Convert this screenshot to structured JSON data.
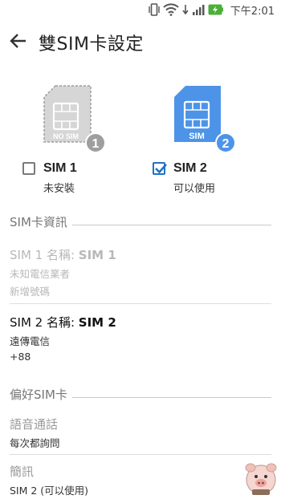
{
  "status_bar": {
    "time": "下午2:01",
    "icons": [
      "vibrate-icon",
      "wifi-icon",
      "signal-icon",
      "battery-charging-icon"
    ]
  },
  "app_bar": {
    "title": "雙SIM卡設定",
    "back_icon": "arrow-left-icon"
  },
  "sim_cards": [
    {
      "slot": "1",
      "graphic_label": "NO SIM",
      "label": "SIM 1",
      "status": "未安裝",
      "checked": false,
      "color": "#9e9e9e"
    },
    {
      "slot": "2",
      "graphic_label": "SIM",
      "label": "SIM 2",
      "status": "可以使用",
      "checked": true,
      "color": "#4d94e8"
    }
  ],
  "sim_info": {
    "header": "SIM卡資訊",
    "sim1": {
      "title_prefix": "SIM 1 名稱: ",
      "title_name": "SIM 1",
      "carrier": "未知電信業者",
      "number": "新增號碼"
    },
    "sim2": {
      "title_prefix": "SIM 2 名稱: ",
      "title_name": "SIM 2",
      "carrier": "遠傳電信",
      "number": "+88"
    }
  },
  "preferred_sim": {
    "header": "偏好SIM卡",
    "voice": {
      "title": "語音通話",
      "value": "每次都詢問"
    },
    "sms": {
      "title": "簡訊",
      "value": "SIM 2 (可以使用)"
    }
  },
  "colors": {
    "accent": "#1e72c8",
    "sim_blue": "#4d94e8",
    "sim_gray": "#9e9e9e"
  }
}
